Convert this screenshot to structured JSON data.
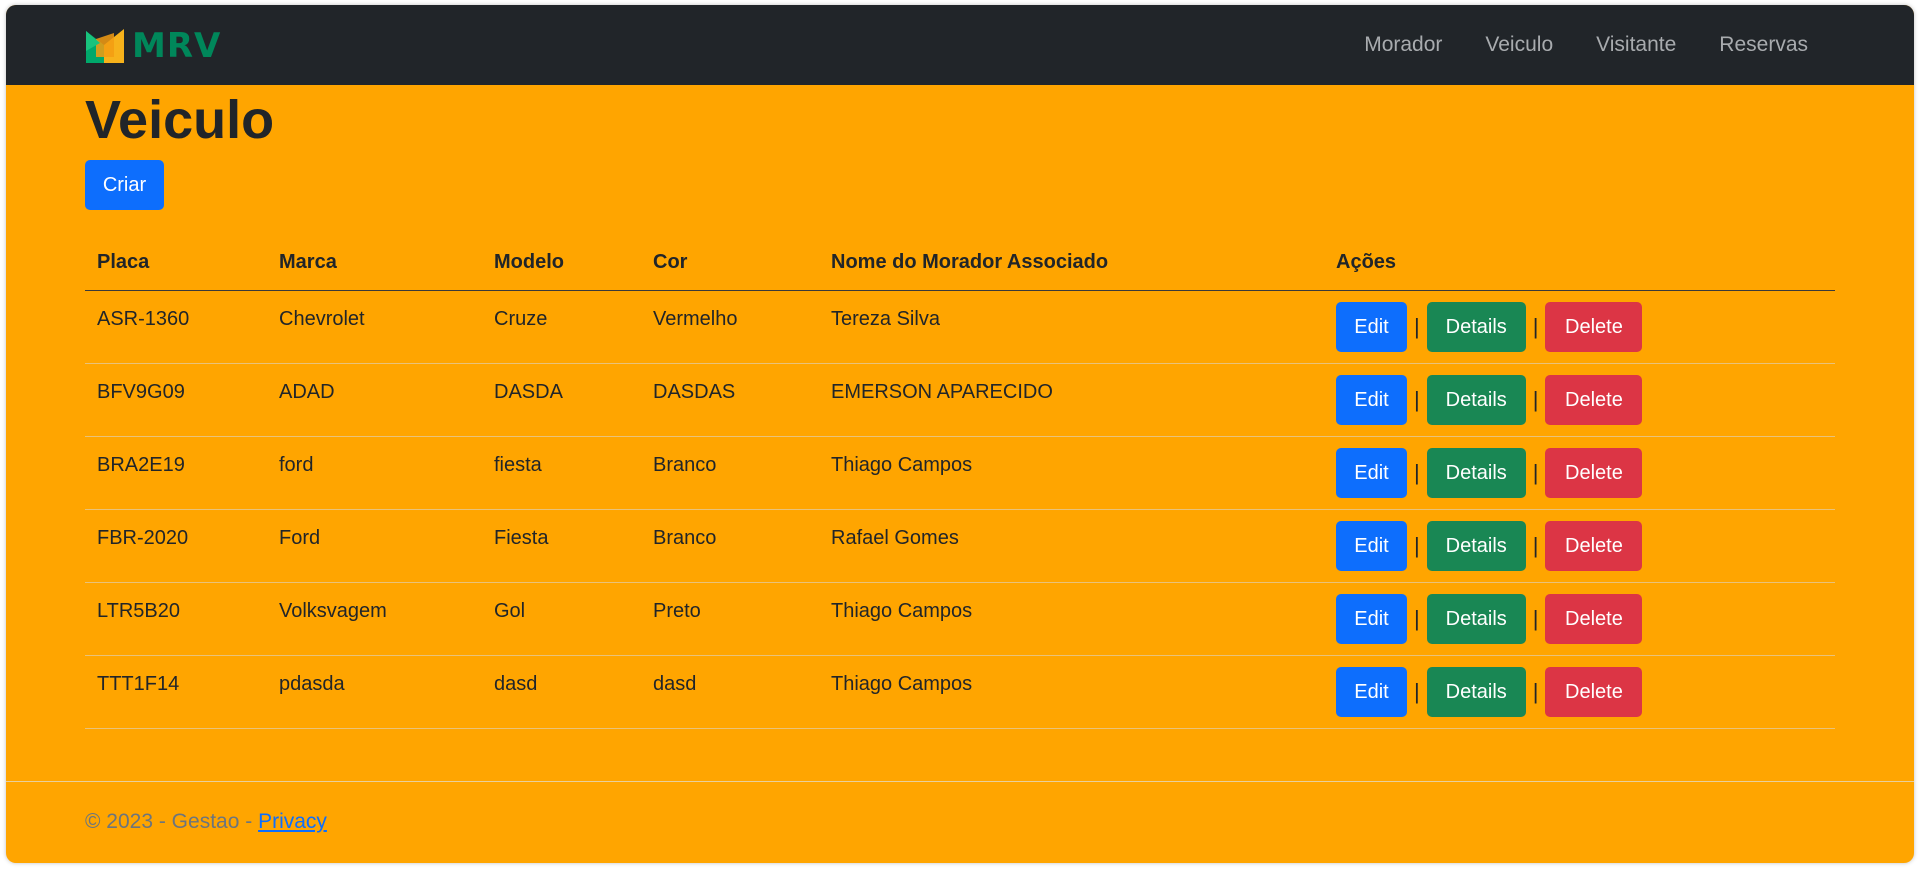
{
  "navbar": {
    "brand": "MRV",
    "links": [
      "Morador",
      "Veiculo",
      "Visitante",
      "Reservas"
    ]
  },
  "page": {
    "title": "Veiculo",
    "create_label": "Criar"
  },
  "table": {
    "headers": [
      "Placa",
      "Marca",
      "Modelo",
      "Cor",
      "Nome do Morador Associado",
      "Ações"
    ],
    "rows": [
      [
        "ASR-1360",
        "Chevrolet",
        "Cruze",
        "Vermelho",
        "Tereza Silva"
      ],
      [
        "BFV9G09",
        "ADAD",
        "DASDA",
        "DASDAS",
        "EMERSON APARECIDO"
      ],
      [
        "BRA2E19",
        "ford",
        "fiesta",
        "Branco",
        "Thiago Campos"
      ],
      [
        "FBR-2020",
        "Ford",
        "Fiesta",
        "Branco",
        "Rafael Gomes"
      ],
      [
        "LTR5B20",
        "Volksvagem",
        "Gol",
        "Preto",
        "Thiago Campos"
      ],
      [
        "TTT1F14",
        "pdasda",
        "dasd",
        "dasd",
        "Thiago Campos"
      ]
    ],
    "actions": {
      "edit": "Edit",
      "details": "Details",
      "delete": "Delete",
      "separator": "|"
    }
  },
  "footer": {
    "text": "© 2023 - Gestao - ",
    "privacy": "Privacy"
  },
  "colors": {
    "navbar_bg": "#212529",
    "page_bg": "#ffa500",
    "brand_green": "#00875a",
    "primary": "#0d6efd",
    "success": "#198754",
    "danger": "#dc3545"
  },
  "icons": {
    "logo": "mrv-logo-icon"
  }
}
